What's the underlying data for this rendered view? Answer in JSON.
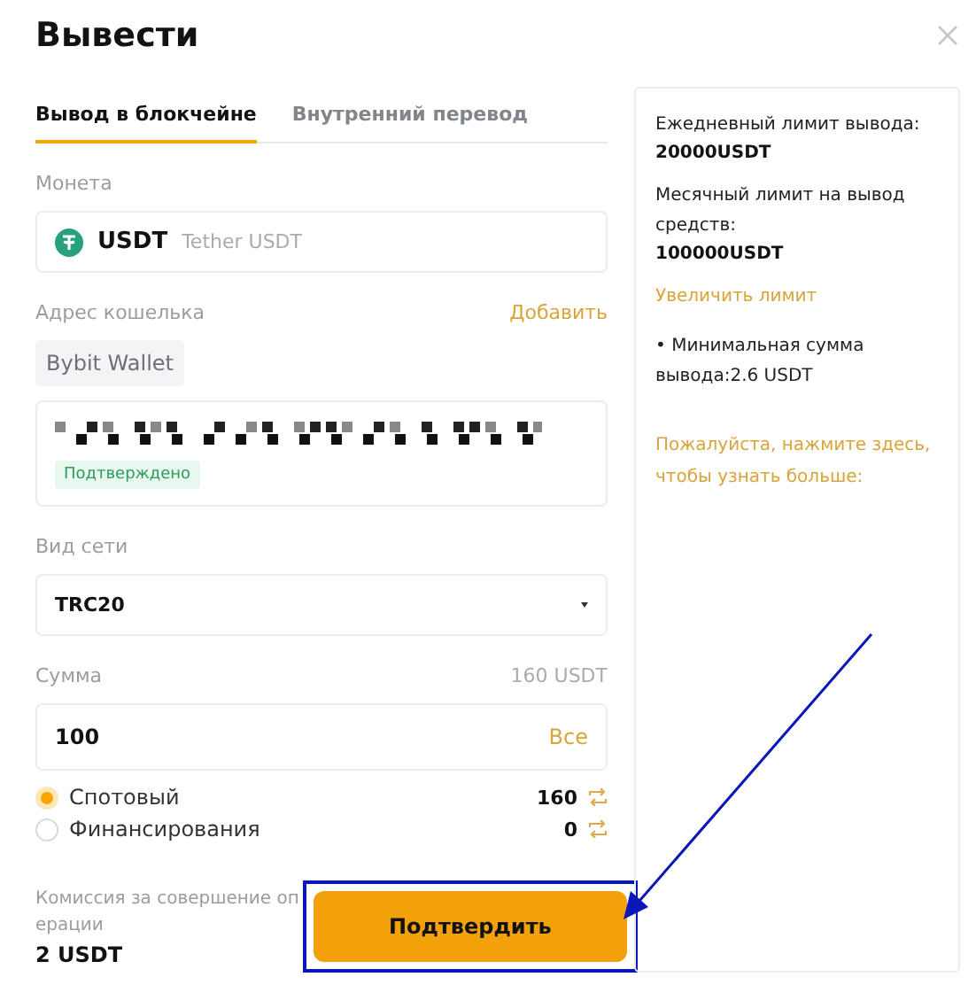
{
  "window": {
    "title": "Вывести"
  },
  "tabs": [
    {
      "label": "Вывод в блокчейне",
      "selected": true
    },
    {
      "label": "Внутренний перевод",
      "selected": false
    }
  ],
  "coin": {
    "label": "Монета",
    "symbol": "USDT",
    "name": "Tether USDT"
  },
  "address": {
    "label": "Адрес кошелька",
    "add_link": "Добавить",
    "wallet_tag": "Bybit Wallet",
    "status": "Подтверждено"
  },
  "network": {
    "label": "Вид сети",
    "value": "TRC20"
  },
  "amount": {
    "label": "Сумма",
    "available": "160 USDT",
    "value": "100",
    "max_link": "Все"
  },
  "accounts": [
    {
      "name": "Спотовый",
      "balance": "160",
      "selected": true
    },
    {
      "name": "Финансирования",
      "balance": "0",
      "selected": false
    }
  ],
  "fee": {
    "label_lines": [
      "Комиссия за совершение оп",
      "ерации"
    ],
    "value": "2 USDT"
  },
  "confirm_button": "Подтвердить",
  "info_panel": [
    {
      "kind": "limit",
      "label": "Ежедневный лимит вывода:",
      "value": "20000USDT"
    },
    {
      "kind": "limit",
      "label": "Месячный лимит на вывод средств:",
      "value": "100000USDT"
    },
    {
      "kind": "link",
      "text": "Увеличить лимит"
    },
    {
      "kind": "bullet",
      "text": "• Минимальная сумма вывода:2.6 USDT"
    },
    {
      "kind": "help",
      "text": "Пожалуйста, нажмите здесь, чтобы узнать больше:"
    }
  ]
}
